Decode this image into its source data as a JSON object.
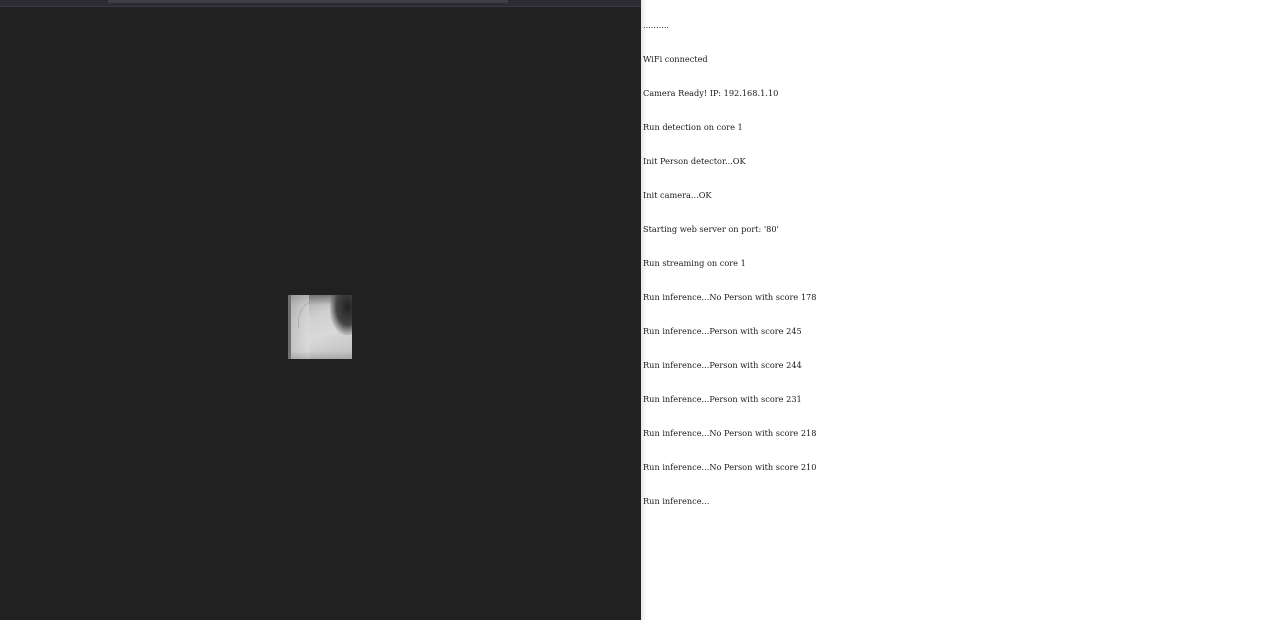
{
  "serial_monitor": {
    "lines": [
      "..........",
      "WiFi connected",
      "Camera Ready! IP: 192.168.1.10",
      "Run detection on core 1",
      "Init Person detector...OK",
      "Init camera...OK",
      "Starting web server on port: '80'",
      "Run streaming on core 1",
      "Run inference...No Person with score 178",
      "Run inference...Person with score 245",
      "Run inference...Person with score 244",
      "Run inference...Person with score 231",
      "Run inference...No Person with score 218",
      "Run inference...No Person with score 210",
      "Run inference..."
    ]
  },
  "colors": {
    "stream_background": "#212121",
    "serial_background": "#ffffff",
    "serial_text": "#1a1a1a"
  }
}
